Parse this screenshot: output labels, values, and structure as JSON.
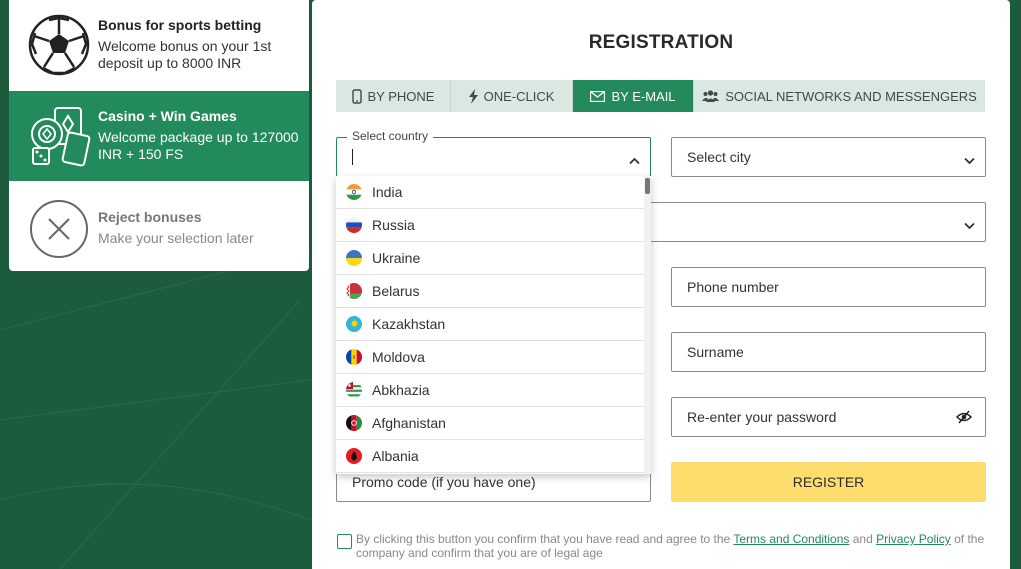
{
  "bonuses": [
    {
      "title": "Bonus for sports betting",
      "desc": "Welcome bonus on your 1st deposit up to 8000 INR",
      "icon": "soccer-ball-icon"
    },
    {
      "title": "Casino + Win Games",
      "desc": "Welcome package up to 127000 INR + 150 FS",
      "icon": "casino-chips-icon"
    },
    {
      "title": "Reject bonuses",
      "desc": "Make your selection later",
      "icon": "reject-x-icon"
    }
  ],
  "registration": {
    "title": "REGISTRATION",
    "tabs": [
      {
        "label": "By phone",
        "icon": "phone-icon"
      },
      {
        "label": "One-click",
        "icon": "lightning-icon"
      },
      {
        "label": "By e-mail",
        "icon": "envelope-icon"
      },
      {
        "label": "Social networks and messengers",
        "icon": "users-icon"
      }
    ],
    "active_tab": "By e-mail",
    "country_label": "Select country",
    "country_value": "",
    "city_placeholder": "Select city",
    "phone_placeholder": "Phone number",
    "surname_placeholder": "Surname",
    "repassword_placeholder": "Re-enter your password",
    "promo_placeholder": "Promo code (if you have one)",
    "register_label": "Register",
    "agree": {
      "part1": "By clicking this button you confirm that you have read and agree to the ",
      "terms": "Terms and Conditions",
      "and": " and ",
      "privacy": "Privacy Policy",
      "part2": " of the company and confirm that you are of legal age"
    }
  },
  "countries": [
    "India",
    "Russia",
    "Ukraine",
    "Belarus",
    "Kazakhstan",
    "Moldova",
    "Abkhazia",
    "Afghanistan",
    "Albania"
  ],
  "colors": {
    "brand_green": "#238a5b",
    "background": "#1c5b3c",
    "register_yellow": "#fdde6c"
  }
}
